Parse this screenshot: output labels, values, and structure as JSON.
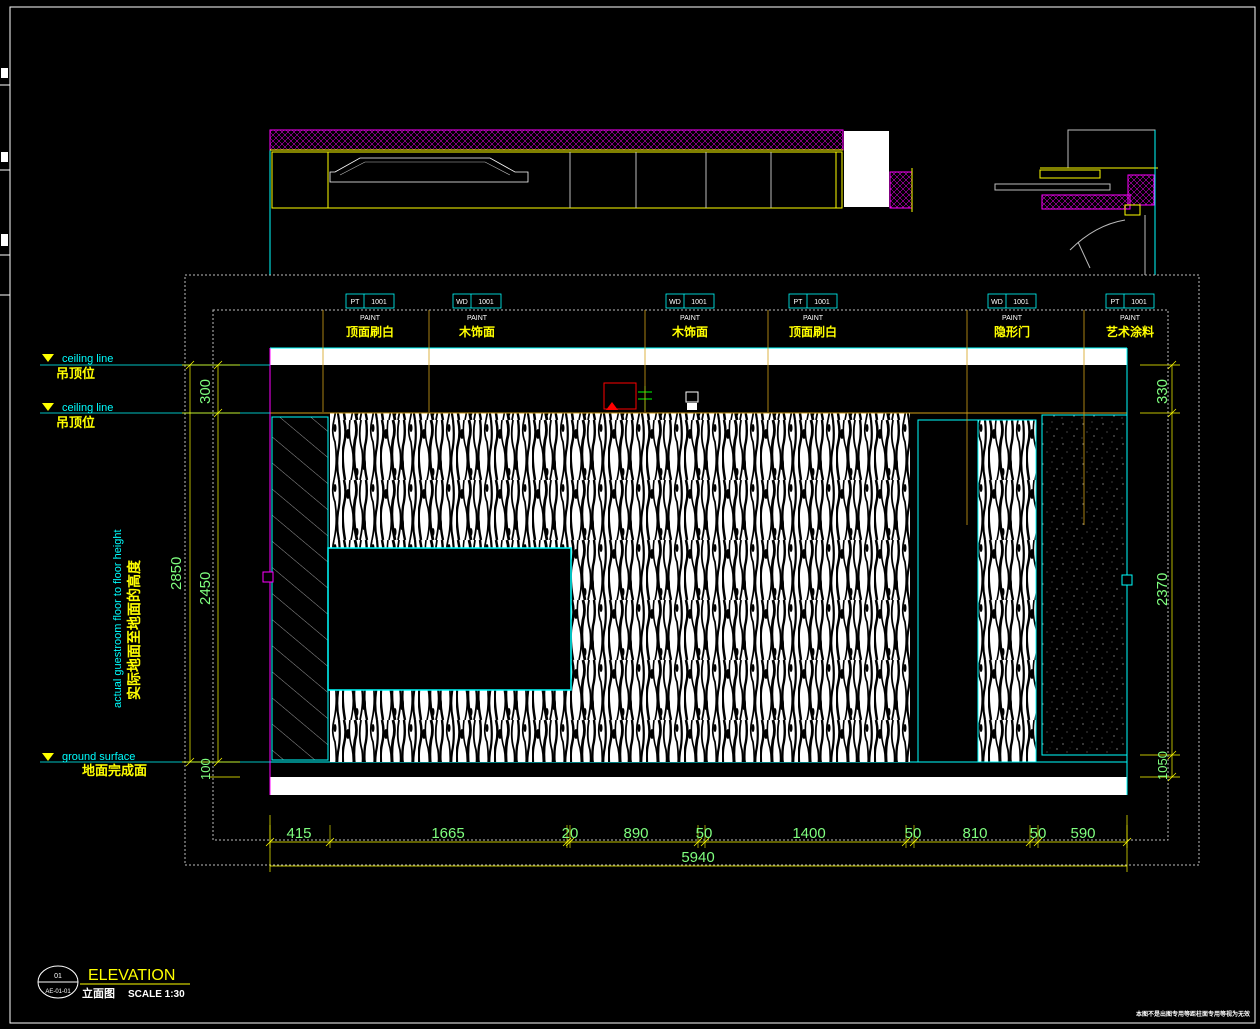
{
  "tags": [
    {
      "code": "PT",
      "num": "1001",
      "sub": "PAINT",
      "desc": "顶面刷白"
    },
    {
      "code": "WD",
      "num": "1001",
      "sub": "PAINT",
      "desc": "木饰面"
    },
    {
      "code": "WD",
      "num": "1001",
      "sub": "PAINT",
      "desc": "木饰面"
    },
    {
      "code": "PT",
      "num": "1001",
      "sub": "PAINT",
      "desc": "顶面刷白"
    },
    {
      "code": "WD",
      "num": "1001",
      "sub": "PAINT",
      "desc": "隐形门"
    },
    {
      "code": "PT",
      "num": "1001",
      "sub": "PAINT",
      "desc": "艺术涂料"
    }
  ],
  "levels": [
    {
      "en": "ceiling line",
      "cn": "吊顶位"
    },
    {
      "en": "ceiling line",
      "cn": "吊顶位"
    },
    {
      "en": "ground surface",
      "cn": "地面完成面"
    }
  ],
  "height_note": {
    "en": "actual guestroom floor to floor height",
    "cn": "实际地面至地面的高度"
  },
  "dims_left": {
    "total": "2850",
    "upper": "300",
    "middle": "2450",
    "lower": "100"
  },
  "dims_right": {
    "upper": "330",
    "middle": "2370",
    "lower": "1050"
  },
  "dims_bottom": [
    "415",
    "1665",
    "20",
    "890",
    "50",
    "1400",
    "50",
    "810",
    "50",
    "590"
  ],
  "dim_total": "5940",
  "title_block": {
    "num": "01",
    "ref": "AE-01-01",
    "title": "ELEVATION",
    "subtitle": "立面图",
    "scale": "SCALE  1:30"
  },
  "footer_note": "本图不是出图专用等距柱面专用等视为无效",
  "colors": {
    "background": "#000000",
    "yellow": "#ffff00",
    "cyan": "#00ffff",
    "magenta": "#ff00ff",
    "orange": "#d4a017",
    "green": "#7fff7f",
    "grey": "#bbbbbb"
  }
}
